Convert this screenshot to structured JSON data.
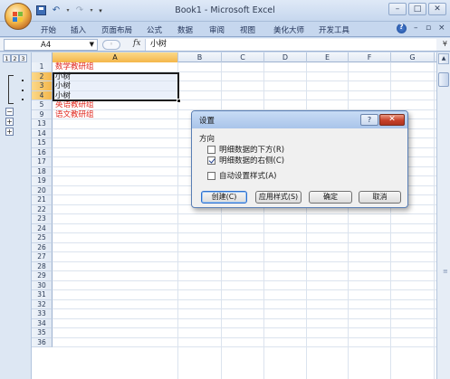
{
  "app": {
    "window_title": "Book1 - Microsoft Excel"
  },
  "ribbon": {
    "tabs": [
      "开始",
      "插入",
      "页面布局",
      "公式",
      "数据",
      "审阅",
      "视图",
      "美化大师",
      "开发工具"
    ]
  },
  "formula_bar": {
    "name_box": "A4",
    "fx_label": "fx",
    "content": "小树"
  },
  "outline": {
    "levels": [
      "1",
      "2",
      "3"
    ]
  },
  "grid": {
    "columns": [
      "A",
      "B",
      "C",
      "D",
      "E",
      "F",
      "G"
    ],
    "active_column": "A",
    "row_numbers": [
      "1",
      "2",
      "3",
      "4",
      "5",
      "9",
      "13",
      "14",
      "15",
      "16",
      "17",
      "18",
      "19",
      "20",
      "21",
      "22",
      "23",
      "24",
      "25",
      "26",
      "27",
      "28",
      "29",
      "30",
      "31",
      "32",
      "33",
      "34",
      "35",
      "36"
    ],
    "cells": [
      {
        "row": "1",
        "text": "数学教研组",
        "color": "#e0281e"
      },
      {
        "row": "2",
        "text": "小树",
        "color": "#1a1a1a"
      },
      {
        "row": "3",
        "text": "小树",
        "color": "#1a1a1a"
      },
      {
        "row": "4",
        "text": "小树",
        "color": "#1a1a1a"
      },
      {
        "row": "5",
        "text": "英语教研组",
        "color": "#e0281e"
      },
      {
        "row": "9",
        "text": "语文教研组",
        "color": "#e0281e"
      }
    ]
  },
  "dialog": {
    "title": "设置",
    "group_label": "方向",
    "options": [
      {
        "label": "明细数据的下方(R)",
        "checked": false
      },
      {
        "label": "明细数据的右侧(C)",
        "checked": true
      },
      {
        "label": "自动设置样式(A)",
        "checked": false
      }
    ],
    "buttons": {
      "create": "创建(C)",
      "apply_styles": "应用样式(S)",
      "ok": "确定",
      "cancel": "取消"
    }
  },
  "colors": {
    "accent": "#c6d7ee",
    "group_header_text": "#e0281e",
    "selection_border": "#1d1d1d"
  }
}
